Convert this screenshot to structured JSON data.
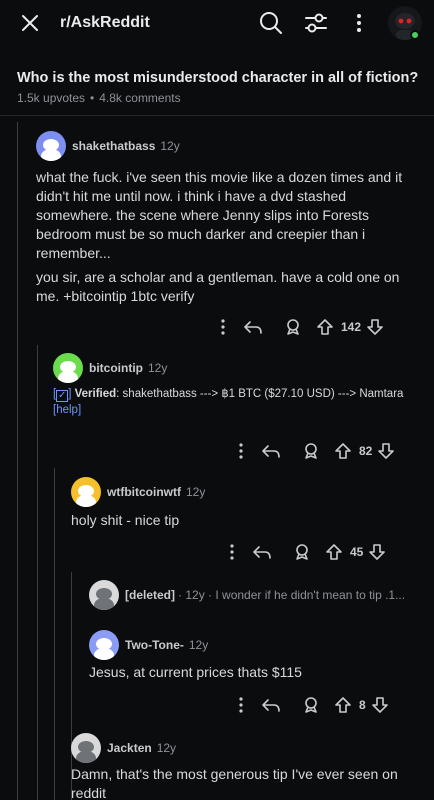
{
  "header": {
    "subreddit": "r/AskReddit",
    "icons": [
      "close-icon",
      "search-icon",
      "filter-icon",
      "more-vertical-icon",
      "profile-avatar"
    ]
  },
  "post": {
    "title": "Who is the most misunderstood character in all of fiction?",
    "upvotes": "1.5k upvotes",
    "separator": "•",
    "comments": "4.8k comments"
  },
  "comments": [
    {
      "user": "shakethatbass",
      "age": "12y",
      "avatar_color": "#7c8ef0",
      "text1": "what the fuck. i've seen this movie like a dozen times and it didn't hit me until now. i think i have a dvd stashed somewhere. the scene where Jenny slips into Forests bedroom must be so much darker and creepier than i remember...",
      "text2": "you sir, are a scholar and a gentleman. have a cold one on me. +bitcointip 1btc verify",
      "score": "142"
    },
    {
      "user": "bitcointip",
      "age": "12y",
      "avatar_color": "#6bdc4c",
      "verified_label": "Verified",
      "verified_text": ": shakethatbass ---> ฿1 BTC ($27.10 USD) ---> Namtara",
      "help": "help",
      "score": "82"
    },
    {
      "user": "wtfbitcoinwtf",
      "age": "12y",
      "avatar_color": "#f5c02b",
      "text": "holy shit - nice tip",
      "score": "45"
    },
    {
      "user": "[deleted]",
      "meta": "· 12y · I wonder if he didn't mean to tip .1...",
      "avatar_color": "#d9d9d9"
    },
    {
      "user": "Two-Tone-",
      "age": "12y",
      "avatar_color": "#8a9cf3",
      "text": "Jesus, at current prices thats $115",
      "score": "8"
    },
    {
      "user": "Jackten",
      "age": "12y",
      "avatar_color": "#d9d9d9",
      "text": "Damn, that's the most generous tip I've ever seen on reddit"
    }
  ],
  "colors": {
    "background": "#0b0c0e",
    "text": "#d7dadc",
    "muted": "#8e9297",
    "link": "#7193ff",
    "online": "#46d160"
  }
}
